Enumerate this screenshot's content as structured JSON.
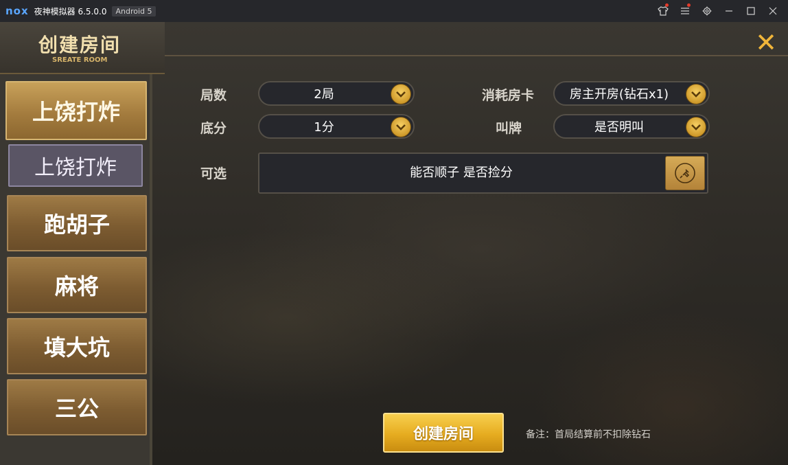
{
  "window": {
    "logo": "nox",
    "title": "夜神模拟器 6.5.0.0",
    "android": "Android 5",
    "controls": [
      "shirt-icon",
      "menu-icon",
      "settings-icon",
      "minimize-icon",
      "maximize-icon",
      "close-icon"
    ]
  },
  "header": {
    "title": "创建房间",
    "subtitle": "SREATE ROOM"
  },
  "sidebar": {
    "main": "上饶打炸",
    "sub": "上饶打炸",
    "items": [
      "跑胡子",
      "麻将",
      "填大坑",
      "三公"
    ]
  },
  "form": {
    "rounds": {
      "label": "局数",
      "value": "2局"
    },
    "cost": {
      "label": "消耗房卡",
      "value": "房主开房(钻石x1)"
    },
    "base": {
      "label": "底分",
      "value": "1分"
    },
    "call": {
      "label": "叫牌",
      "value": "是否明叫"
    },
    "optional": {
      "label": "可选",
      "value": "能否顺子 是否捡分"
    }
  },
  "create_button": "创建房间",
  "note": "备注：首局结算前不扣除钻石",
  "colors": {
    "gold": "#e6ac20",
    "accent": "#f0b53a"
  }
}
